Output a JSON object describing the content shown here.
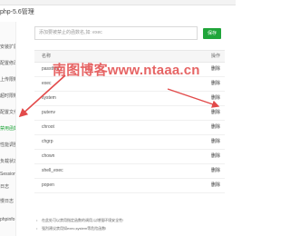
{
  "top_tabs": [
    "",
    "",
    "",
    ""
  ],
  "window": {
    "title": "php-5.6管理"
  },
  "sidebar": {
    "items": [
      {
        "label": "安装扩展"
      },
      {
        "label": "配置修改"
      },
      {
        "label": "上传限制"
      },
      {
        "label": "超时限制"
      },
      {
        "label": "配置文件"
      },
      {
        "label": "禁用函数"
      },
      {
        "label": "性能调整"
      },
      {
        "label": "负载状态"
      },
      {
        "label": "Session配置"
      },
      {
        "label": "日志"
      },
      {
        "label": "慢日志"
      },
      {
        "label": "phpinfo"
      }
    ],
    "active_index": 5
  },
  "search": {
    "placeholder": "添加要被禁止的函数名,如: exec",
    "save_label": "保存"
  },
  "table": {
    "headers": {
      "name": "名称",
      "action": "操作"
    },
    "rows": [
      {
        "name": "passthru",
        "action": "删除"
      },
      {
        "name": "exec",
        "action": "删除"
      },
      {
        "name": "system",
        "action": "删除"
      },
      {
        "name": "putenv",
        "action": "删除"
      },
      {
        "name": "chroot",
        "action": "删除"
      },
      {
        "name": "chgrp",
        "action": "删除"
      },
      {
        "name": "chown",
        "action": "删除"
      },
      {
        "name": "shell_exec",
        "action": "删除"
      },
      {
        "name": "popen",
        "action": "删除"
      }
    ]
  },
  "tips": [
    "在此处可以禁用指定函数的调用,以增强环境安全性!",
    "强烈建议禁用如exec,system等危险函数!"
  ],
  "watermark": {
    "text": "南图博客www.ntaaa.cn"
  },
  "colors": {
    "accent": "#20a53a",
    "annotation": "#e24a4a"
  }
}
